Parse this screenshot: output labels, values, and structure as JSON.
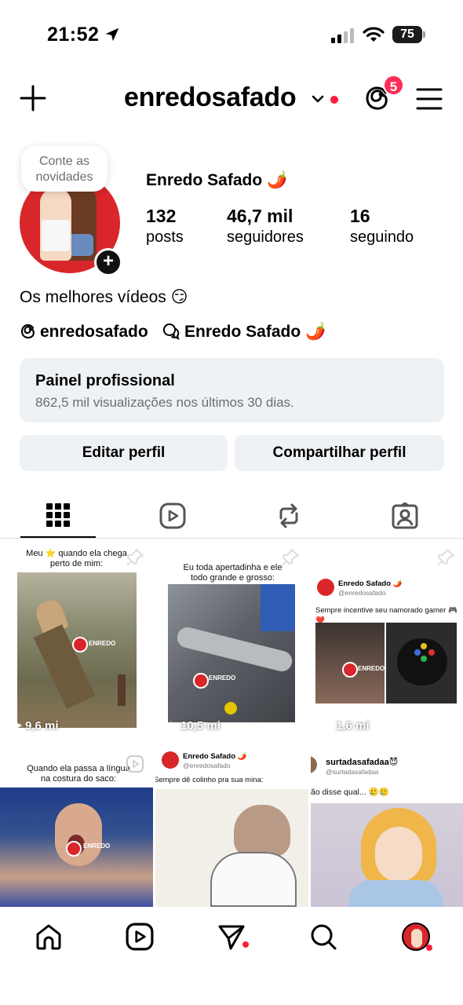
{
  "status_bar": {
    "time": "21:52",
    "battery": "75"
  },
  "header": {
    "username": "enredosafado",
    "notification_count": "5"
  },
  "profile": {
    "note": "Conte as novidades",
    "full_name": "Enredo Safado 🌶️",
    "stats": [
      {
        "value": "132",
        "label": "posts"
      },
      {
        "value": "46,7 mil",
        "label": "seguidores"
      },
      {
        "value": "16",
        "label": "seguindo"
      }
    ],
    "bio": "Os melhores vídeos 😏",
    "threads_link": "enredosafado",
    "channel_link": "Enredo Safado 🌶️"
  },
  "pro_panel": {
    "title": "Painel profissional",
    "subtitle": "862,5 mil visualizações nos últimos 30 dias."
  },
  "buttons": {
    "edit": "Editar perfil",
    "share": "Compartilhar perfil"
  },
  "tabs": [
    "grid-icon",
    "reels-icon",
    "reposts-icon",
    "tagged-icon"
  ],
  "posts": [
    {
      "caption": "Meu ⭐ quando ela chega perto de mim:",
      "views": "9,6 mi",
      "watermark": "ENREDO"
    },
    {
      "caption": "Eu toda apertadinha e ele todo grande e grosso:",
      "views": "10,5 mi",
      "watermark": "ENREDO"
    },
    {
      "tweet_name": "Enredo Safado 🌶️",
      "tweet_handle": "@enredosafado",
      "caption": "Sempre incentive seu namorado gamer 🎮❤️",
      "views": "1,6 mi",
      "watermark": "ENREDO"
    },
    {
      "caption": "Quando ela passa a língua na costura do saco:",
      "watermark": "ENREDO"
    },
    {
      "tweet_name": "Enredo Safado 🌶️",
      "tweet_handle": "@enredosafado",
      "caption": "Sempre dê colinho pra sua mina:"
    },
    {
      "tweet_name": "surtadasafadaa😈",
      "tweet_handle": "@surtadasafadaa",
      "caption": "ão disse qual... 🥲🥲"
    }
  ],
  "colors": {
    "accent_red": "#ff1b3a",
    "panel_bg": "#eff2f5",
    "brand_red": "#d8262a"
  }
}
